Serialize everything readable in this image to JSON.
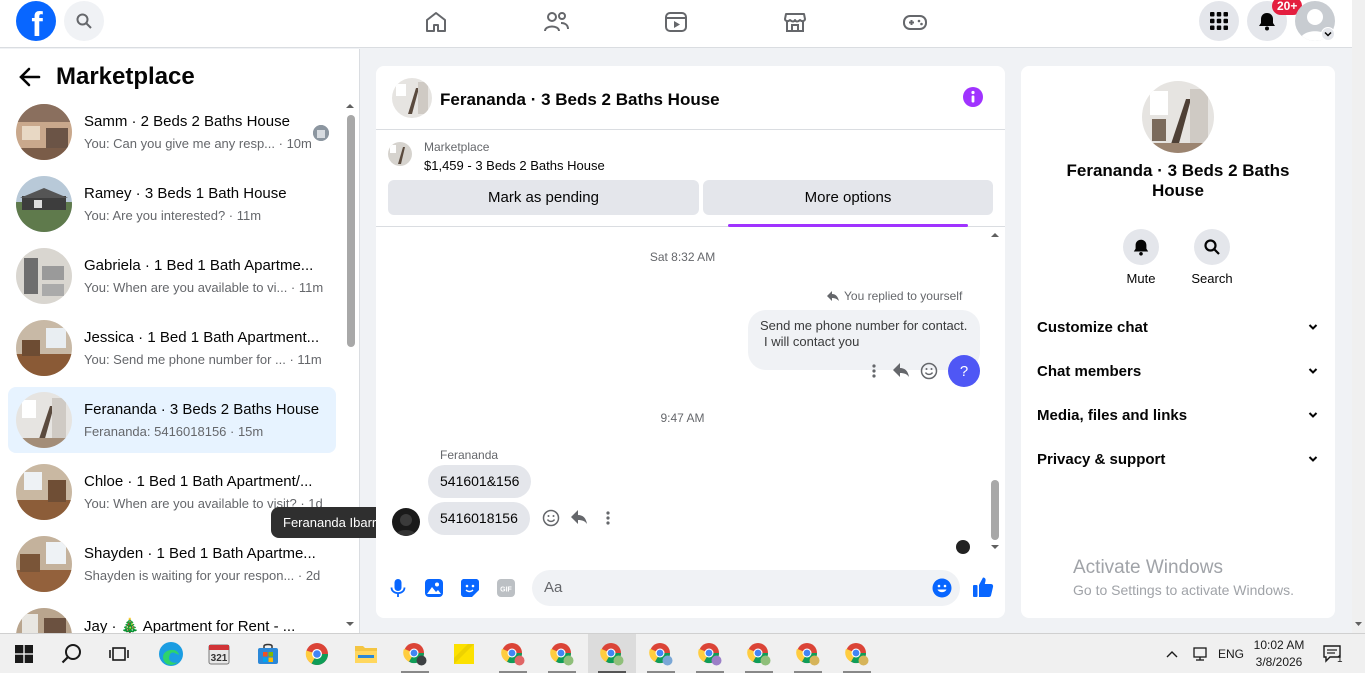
{
  "topbar": {
    "notification_badge": "20+",
    "brand_color": "#0866ff"
  },
  "left": {
    "title": "Marketplace",
    "conversations": [
      {
        "title": "Samm · 2 Beds 2 Baths House",
        "snippet": "You: Can you give me any resp... · 10m"
      },
      {
        "title": "Ramey · 3 Beds 1 Bath House",
        "snippet": "You: Are you interested? · 11m"
      },
      {
        "title": "Gabriela · 1 Bed 1 Bath Apartme...",
        "snippet": "You: When are you available to vi... · 11m"
      },
      {
        "title": "Jessica · 1 Bed 1 Bath Apartment...",
        "snippet": "You: Send me phone number for ... · 11m"
      },
      {
        "title": "Ferananda · 3 Beds 2 Baths House",
        "snippet": "Ferananda: 5416018156 · 15m"
      },
      {
        "title": "Chloe · 1 Bed 1 Bath Apartment/...",
        "snippet": "You: When are you available to visit? · 1d"
      },
      {
        "title": "Shayden · 1 Bed 1 Bath Apartme...",
        "snippet": "Shayden is waiting for your respon... · 2d"
      },
      {
        "title": "Jay · 🎄 Apartment for Rent - ...",
        "snippet": ""
      }
    ],
    "tooltip": "Feranandа Ibarra"
  },
  "chat": {
    "title": "Ferananda · 3 Beds 2 Baths House",
    "listing_source": "Marketplace",
    "listing_price_title": "$1,459 - 3 Beds 2 Baths House",
    "mark_pending": "Mark as pending",
    "more_options": "More options",
    "time1": "Sat 8:32 AM",
    "replied_note": "You replied to yourself",
    "my_message_line1": "Send me phone number for contact.",
    "my_message_line2": "I will contact you",
    "time2": "9:47 AM",
    "sender_name": "Ferananda",
    "msg1": "541601&156",
    "msg2": "5416018156",
    "composer_placeholder": "Aa"
  },
  "right": {
    "title": "Ferananda · 3 Beds 2 Baths House",
    "mute_label": "Mute",
    "search_label": "Search",
    "rows": [
      "Customize chat",
      "Chat members",
      "Media, files and links",
      "Privacy & support"
    ],
    "watermark_title": "Activate Windows",
    "watermark_sub": "Go to Settings to activate Windows."
  },
  "taskbar": {
    "lang": "ENG",
    "time": "10:02 AM",
    "date": "3/8/2026",
    "notif_count": "1"
  }
}
